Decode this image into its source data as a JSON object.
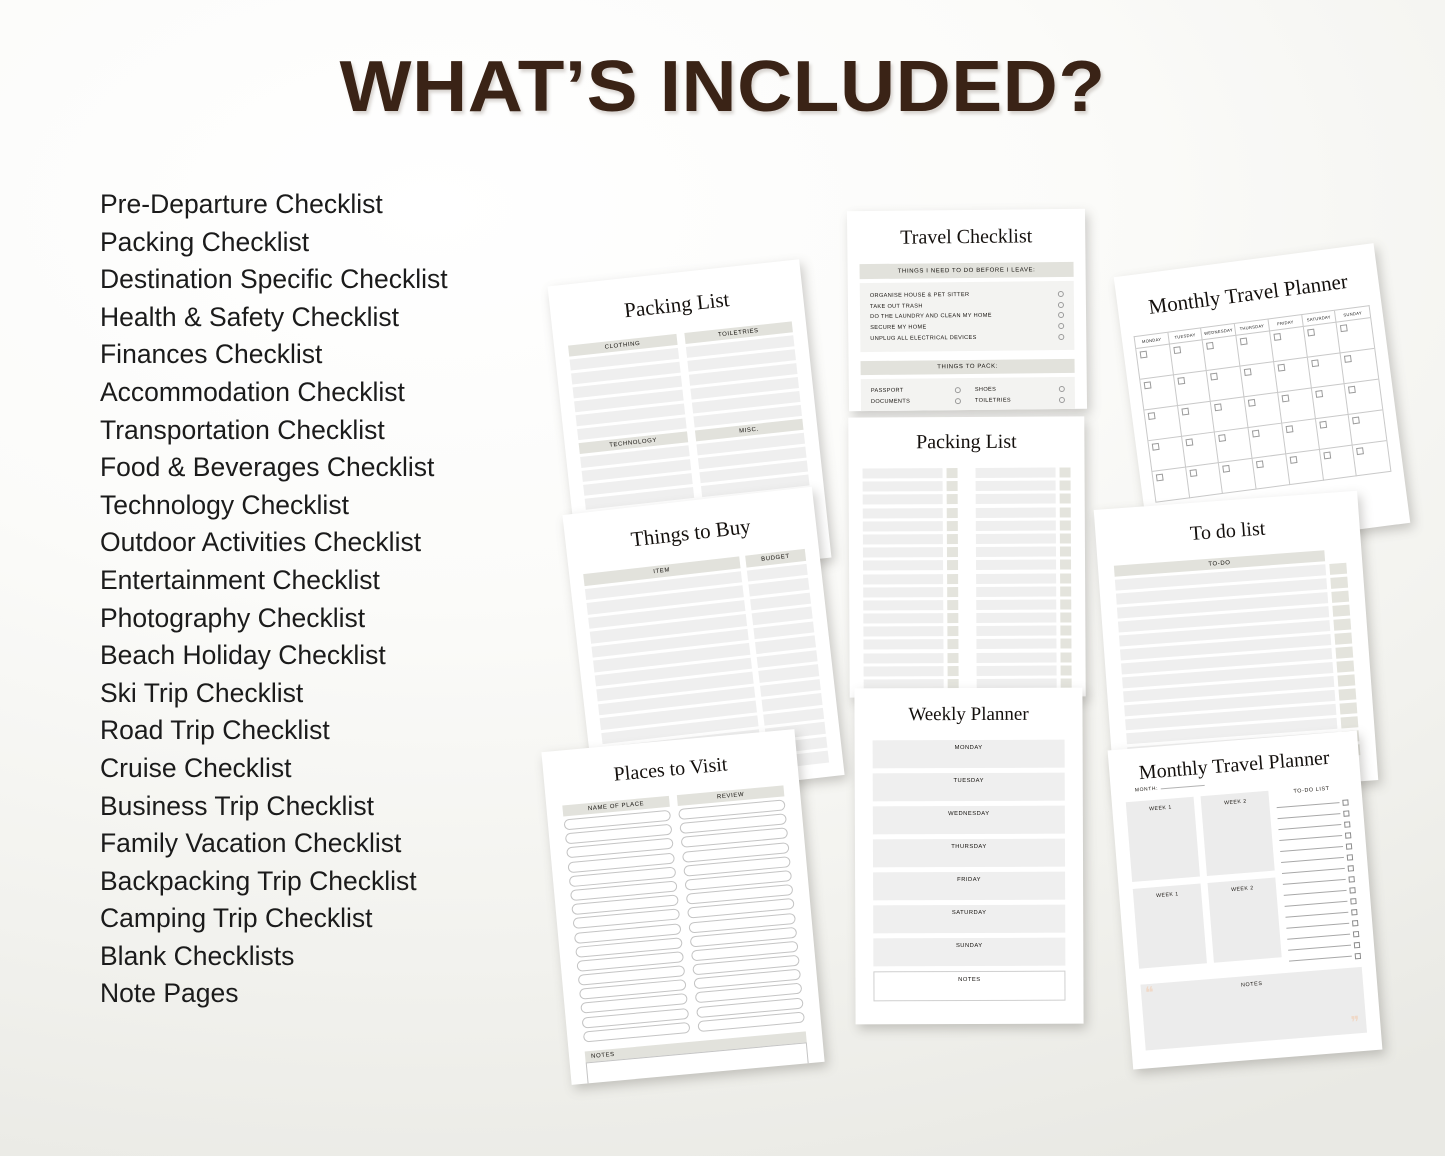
{
  "header": {
    "title": "WHAT’S INCLUDED?",
    "title_color": "#3a2316"
  },
  "features": [
    "Pre-Departure Checklist",
    "Packing Checklist",
    "Destination Specific Checklist",
    "Health & Safety Checklist",
    "Finances Checklist",
    "Accommodation Checklist",
    "Transportation Checklist",
    "Food & Beverages Checklist",
    "Technology Checklist",
    "Outdoor Activities Checklist",
    "Entertainment Checklist",
    "Photography Checklist",
    "Beach Holiday Checklist",
    "Ski Trip Checklist",
    "Road Trip Checklist",
    "Cruise Checklist",
    "Business Trip Checklist",
    "Family Vacation Checklist",
    "Backpacking Trip Checklist",
    "Camping Trip Checklist",
    "Blank Checklists",
    "Note Pages"
  ],
  "pages": {
    "packing_list_top": {
      "title": "Packing List",
      "sections": [
        "CLOTHING",
        "TOILETRIES",
        "TECHNOLOGY",
        "MISC."
      ]
    },
    "travel_checklist": {
      "title": "Travel Checklist",
      "before_leave_header": "THINGS I NEED TO DO BEFORE I LEAVE:",
      "before_leave_items": [
        "ORGANISE HOUSE & PET SITTER",
        "TAKE OUT TRASH",
        "DO THE LAUNDRY AND CLEAN MY HOME",
        "SECURE MY HOME",
        "UNPLUG ALL ELECTRICAL DEVICES"
      ],
      "pack_header": "THINGS TO PACK:",
      "pack_items": [
        "PASSPORT",
        "SHOES",
        "DOCUMENTS",
        "TOILETRIES"
      ]
    },
    "monthly_planner_top": {
      "title": "Monthly Travel Planner",
      "weekdays": [
        "MONDAY",
        "TUESDAY",
        "WEDNESDAY",
        "THURSDAY",
        "FRIDAY",
        "SATURDAY",
        "SUNDAY"
      ]
    },
    "packing_list_mid": {
      "title": "Packing List"
    },
    "todo_list": {
      "title": "To do list",
      "column_header": "TO-DO"
    },
    "things_to_buy": {
      "title": "Things to Buy",
      "col_item": "ITEM",
      "col_budget": "BUDGET"
    },
    "weekly_planner": {
      "title": "Weekly Planner",
      "days": [
        "MONDAY",
        "TUESDAY",
        "WEDNESDAY",
        "THURSDAY",
        "FRIDAY",
        "SATURDAY",
        "SUNDAY"
      ],
      "notes_label": "NOTES"
    },
    "monthly_planner_bottom": {
      "title": "Monthly Travel Planner",
      "month_label": "MONTH:",
      "week_boxes": [
        "WEEK 1",
        "WEEK 2",
        "WEEK 1",
        "WEEK 2"
      ],
      "todo_label": "TO-DO LIST",
      "notes_label": "NOTES"
    },
    "places_to_visit": {
      "title": "Places to Visit",
      "col_name": "NAME OF PLACE",
      "col_review": "REVIEW",
      "notes_label": "NOTES"
    }
  }
}
